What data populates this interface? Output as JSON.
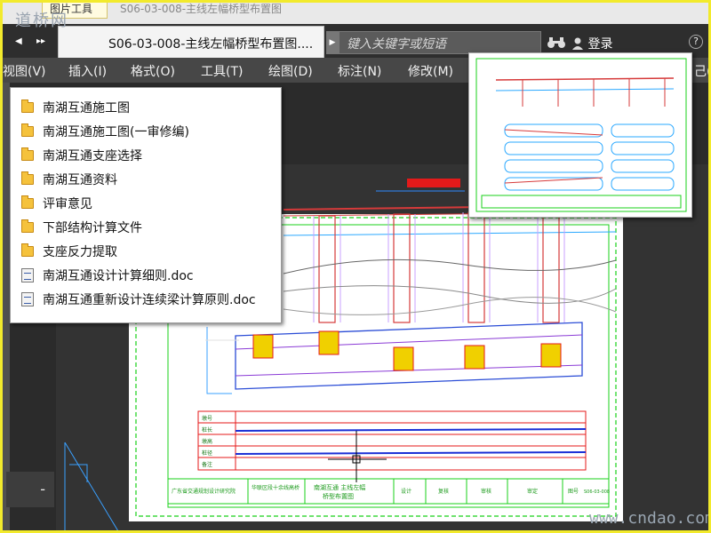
{
  "top_strip": {
    "tab_label": "图片工具",
    "faded_text": "S06-03-008-主线左幅桥型布置图",
    "watermark": "道桥网"
  },
  "title_bar": {
    "document_tab": "S06-03-008-主线左幅桥型布置图....",
    "search_placeholder": "键入关键字或短语",
    "login_label": "登录",
    "help_label": "?",
    "tab_chevron": "▸▸"
  },
  "menu": [
    {
      "label": "视图(V)"
    },
    {
      "label": "插入(I)"
    },
    {
      "label": "格式(O)"
    },
    {
      "label": "工具(T)"
    },
    {
      "label": "绘图(D)"
    },
    {
      "label": "标注(N)"
    },
    {
      "label": "修改(M)"
    },
    {
      "label": "己("
    }
  ],
  "file_list": [
    {
      "name": "南湖互通施工图",
      "icon": "folder"
    },
    {
      "name": "南湖互通施工图(一审修编)",
      "icon": "folder"
    },
    {
      "name": "南湖互通支座选择",
      "icon": "folder"
    },
    {
      "name": "南湖互通资料",
      "icon": "folder"
    },
    {
      "name": "评审意见",
      "icon": "folder"
    },
    {
      "name": "下部结构计算文件",
      "icon": "folder"
    },
    {
      "name": "支座反力提取",
      "icon": "folder"
    },
    {
      "name": "南湖互通设计计算细则.doc",
      "icon": "doc"
    },
    {
      "name": "南湖互通重新设计连续梁计算原则.doc",
      "icon": "doc"
    }
  ],
  "panel": {
    "minus_label": "-"
  },
  "drawing": {
    "table_rows": [
      "墩号",
      "桩长",
      "墩高",
      "桩径",
      "备注"
    ],
    "title_block": [
      "广东省交通规划设计研究院",
      "华联区段十余线高桥",
      "南湖互通 主线左幅",
      "桥型布置图",
      "设计",
      "复核",
      "审核",
      "审定",
      "图号"
    ],
    "sheet_no": "S06-03-008"
  },
  "site_watermark": "www.cndao.com",
  "colors": {
    "frame": "#f2ea2c",
    "canvas": "#2b2b2b",
    "menubar": "#474747"
  }
}
